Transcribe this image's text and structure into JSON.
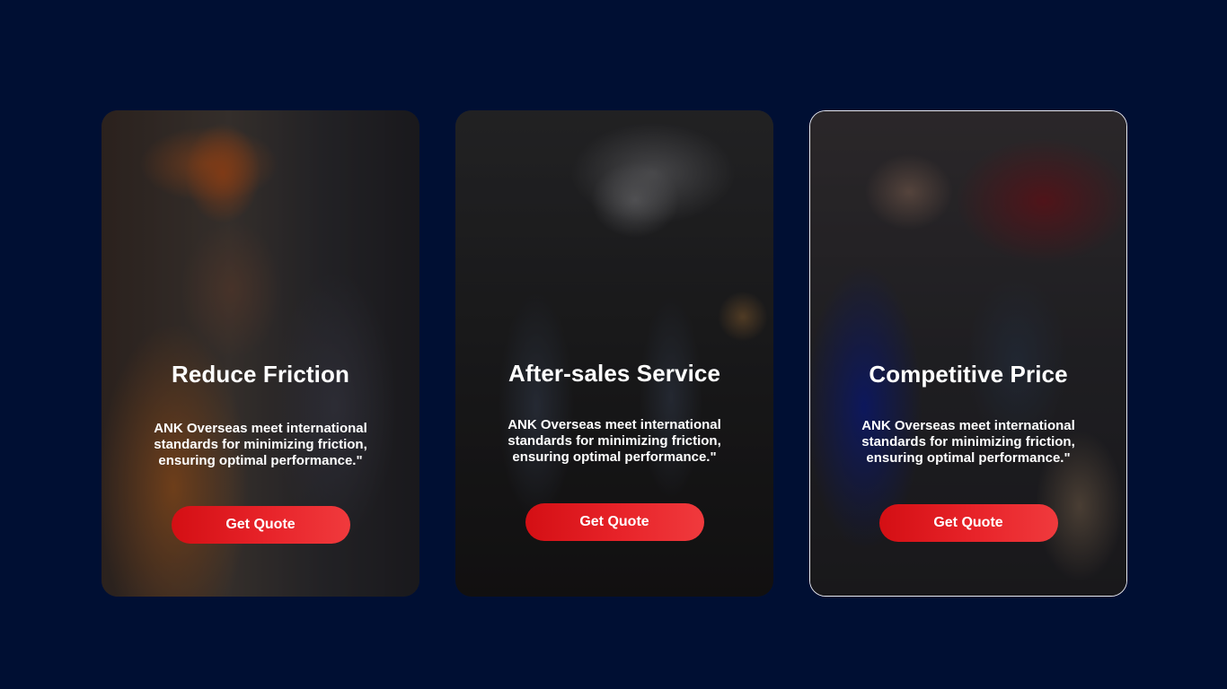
{
  "background_color": "#000f33",
  "accent_color": "#e8242a",
  "cards": [
    {
      "title": "Reduce Friction",
      "text": "ANK Overseas meet international standards for minimizing friction, ensuring optimal performance.\"",
      "button_label": "Get Quote",
      "image": "engineer-in-hard-hat-photo"
    },
    {
      "title": "After-sales Service",
      "text": "ANK Overseas meet international standards for minimizing friction, ensuring optimal performance.\"",
      "button_label": "Get Quote",
      "image": "mechanics-under-lifted-car-photo"
    },
    {
      "title": "Competitive Price",
      "text": "ANK Overseas meet international standards for minimizing friction, ensuring optimal performance.\"",
      "button_label": "Get Quote",
      "image": "mechanic-with-customer-tablet-photo"
    }
  ]
}
